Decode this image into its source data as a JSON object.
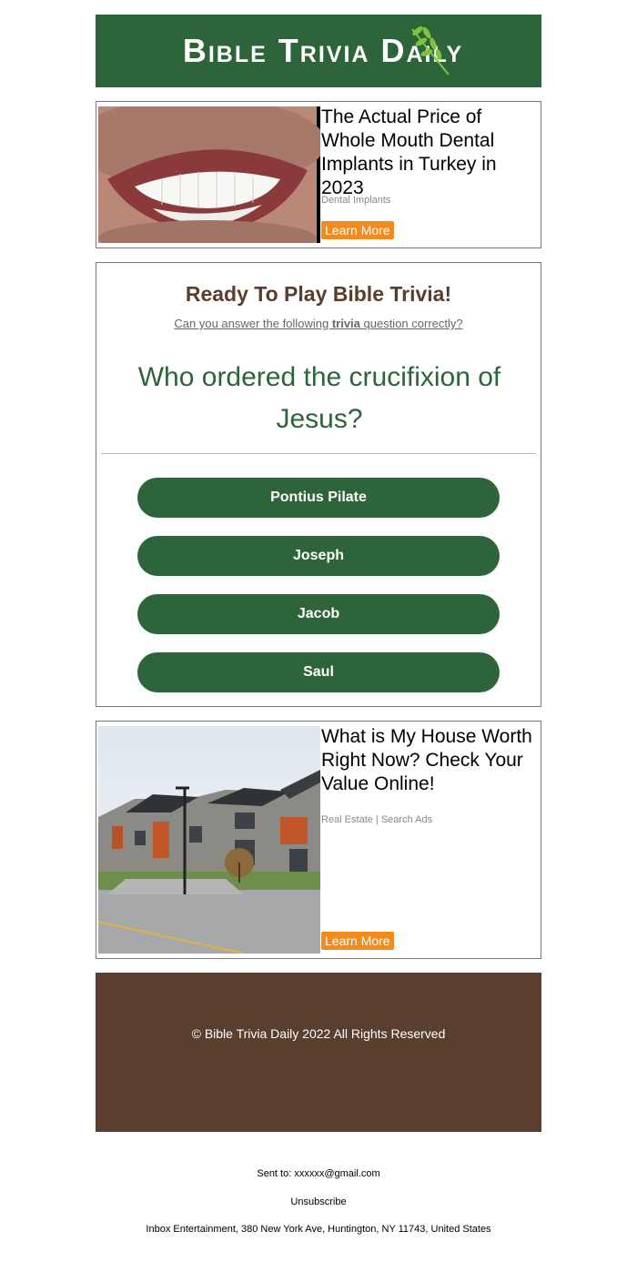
{
  "header": {
    "logo_text": "Bible Trivia Daily",
    "bg_color": "#2e6439"
  },
  "ad_top": {
    "title": "The Actual Price of Whole Mouth Dental Implants in Turkey in 2023",
    "category": "Dental Implants",
    "button": "Learn More",
    "image": "smile-dental-implants-photo"
  },
  "quiz": {
    "heading": "Ready To Play Bible Trivia!",
    "sub_before": "Can you answer the following ",
    "sub_bold": "trivia",
    "sub_after": " question correctly?",
    "question": "Who ordered the crucifixion of Jesus?",
    "answers": [
      "Pontius Pilate",
      "Joseph",
      "Jacob",
      "Saul"
    ]
  },
  "ad_bottom": {
    "title": "What is My House Worth Right Now? Check Your Value Online!",
    "category": "Real Estate | Search Ads",
    "button": "Learn More",
    "image": "modern-townhouses-photo"
  },
  "footer": {
    "copyright": "© Bible Trivia Daily 2022 All Rights Reserved",
    "bg_color": "#5a3e2e"
  },
  "meta": {
    "sent_to": "Sent to: xxxxxx@gmail.com",
    "unsubscribe": "Unsubscribe",
    "address": "Inbox Entertainment, 380 New York Ave, Huntington, NY 11743, United States"
  },
  "colors": {
    "accent_green": "#2e6439",
    "button_orange": "#f28a1c",
    "brown": "#5a3e2b"
  }
}
